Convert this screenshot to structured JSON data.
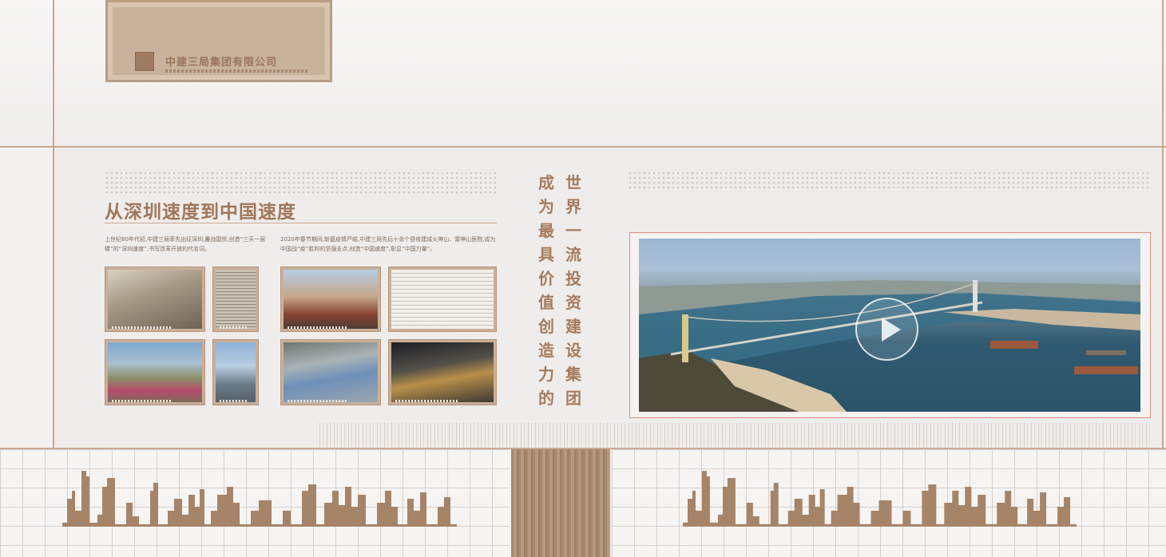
{
  "plaque": {
    "company_name": "中建三局集团有限公司"
  },
  "section": {
    "heading": "从深圳速度到中国速度",
    "paragraph_left": "上世纪80年代初,中建三局率先出征深圳,鏖战国贸,创造“三天一层楼”的“深圳速度”,书写改革开放的代名词。",
    "paragraph_right": "2020年春节期间,斩瘟疫情严峻,中建三局先后十余个昼夜建成火神山、雷神山医院,成为中国战“疫”胜利的坚强支点,创造“中国速度”,彰显“中国力量”。"
  },
  "slogan": {
    "column_right": "世界一流投资建设集团",
    "column_left": "成为最具价值创造力的"
  },
  "video": {
    "play_icon": "play-icon"
  },
  "colors": {
    "accent": "#a77b5d",
    "line": "#c9a890",
    "frame": "#d98f7d"
  }
}
